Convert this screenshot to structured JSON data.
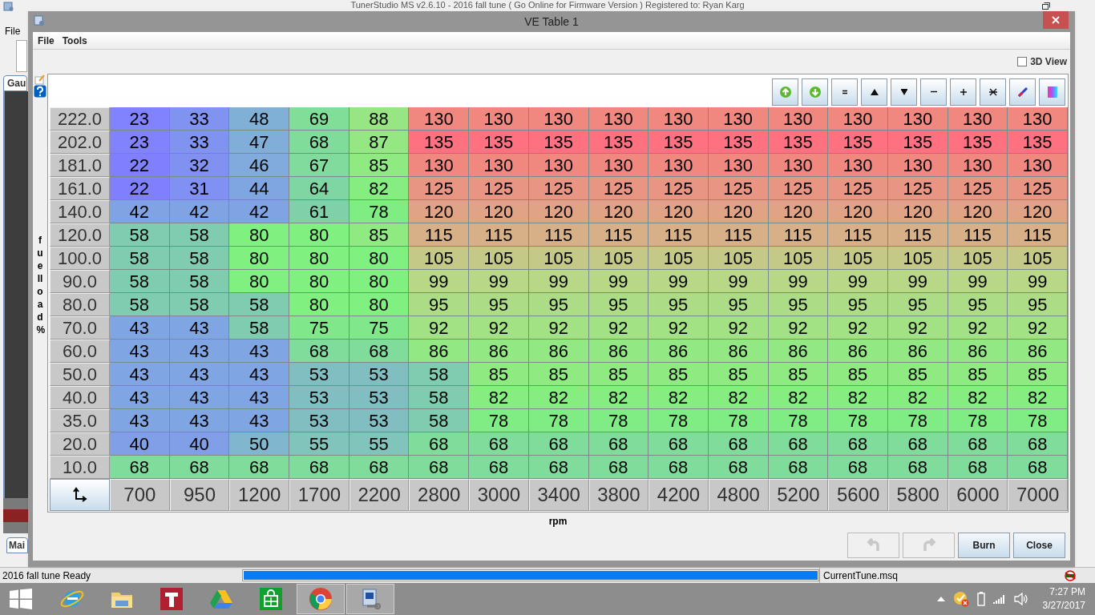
{
  "background_app": {
    "title": "TunerStudio MS v2.6.10 - 2016 fall tune ( Go Online for Firmware Version ) Registered to: Ryan Karg",
    "menu": [
      "File"
    ],
    "tabs": [
      {
        "label": "Gau",
        "selected": true
      },
      {
        "label": "Mai",
        "selected": true
      }
    ]
  },
  "window": {
    "title": "VE Table 1",
    "menu": [
      "File",
      "Tools"
    ]
  },
  "view_3d": {
    "label": "3D View",
    "checked": false
  },
  "table": {
    "y_axis_label": "fuelload %",
    "rows": [
      {
        "load": "222.0",
        "cells": [
          "23",
          "33",
          "48",
          "69",
          "88",
          "130",
          "130",
          "130",
          "130",
          "130",
          "130",
          "130",
          "130",
          "130",
          "130",
          "130"
        ]
      },
      {
        "load": "202.0",
        "cells": [
          "23",
          "33",
          "47",
          "68",
          "87",
          "135",
          "135",
          "135",
          "135",
          "135",
          "135",
          "135",
          "135",
          "135",
          "135",
          "135"
        ]
      },
      {
        "load": "181.0",
        "cells": [
          "22",
          "32",
          "46",
          "67",
          "85",
          "130",
          "130",
          "130",
          "130",
          "130",
          "130",
          "130",
          "130",
          "130",
          "130",
          "130"
        ]
      },
      {
        "load": "161.0",
        "cells": [
          "22",
          "31",
          "44",
          "64",
          "82",
          "125",
          "125",
          "125",
          "125",
          "125",
          "125",
          "125",
          "125",
          "125",
          "125",
          "125"
        ]
      },
      {
        "load": "140.0",
        "cells": [
          "42",
          "42",
          "42",
          "61",
          "78",
          "120",
          "120",
          "120",
          "120",
          "120",
          "120",
          "120",
          "120",
          "120",
          "120",
          "120"
        ]
      },
      {
        "load": "120.0",
        "cells": [
          "58",
          "58",
          "80",
          "80",
          "85",
          "115",
          "115",
          "115",
          "115",
          "115",
          "115",
          "115",
          "115",
          "115",
          "115",
          "115"
        ]
      },
      {
        "load": "100.0",
        "cells": [
          "58",
          "58",
          "80",
          "80",
          "80",
          "105",
          "105",
          "105",
          "105",
          "105",
          "105",
          "105",
          "105",
          "105",
          "105",
          "105"
        ]
      },
      {
        "load": "90.0",
        "cells": [
          "58",
          "58",
          "80",
          "80",
          "80",
          "99",
          "99",
          "99",
          "99",
          "99",
          "99",
          "99",
          "99",
          "99",
          "99",
          "99"
        ]
      },
      {
        "load": "80.0",
        "cells": [
          "58",
          "58",
          "58",
          "80",
          "80",
          "95",
          "95",
          "95",
          "95",
          "95",
          "95",
          "95",
          "95",
          "95",
          "95",
          "95"
        ]
      },
      {
        "load": "70.0",
        "cells": [
          "43",
          "43",
          "58",
          "75",
          "75",
          "92",
          "92",
          "92",
          "92",
          "92",
          "92",
          "92",
          "92",
          "92",
          "92",
          "92"
        ]
      },
      {
        "load": "60.0",
        "cells": [
          "43",
          "43",
          "43",
          "68",
          "68",
          "86",
          "86",
          "86",
          "86",
          "86",
          "86",
          "86",
          "86",
          "86",
          "86",
          "86"
        ]
      },
      {
        "load": "50.0",
        "cells": [
          "43",
          "43",
          "43",
          "53",
          "53",
          "58",
          "85",
          "85",
          "85",
          "85",
          "85",
          "85",
          "85",
          "85",
          "85",
          "85"
        ]
      },
      {
        "load": "40.0",
        "cells": [
          "43",
          "43",
          "43",
          "53",
          "53",
          "58",
          "82",
          "82",
          "82",
          "82",
          "82",
          "82",
          "82",
          "82",
          "82",
          "82"
        ]
      },
      {
        "load": "35.0",
        "cells": [
          "43",
          "43",
          "43",
          "53",
          "53",
          "58",
          "78",
          "78",
          "78",
          "78",
          "78",
          "78",
          "78",
          "78",
          "78",
          "78"
        ]
      },
      {
        "load": "20.0",
        "cells": [
          "40",
          "40",
          "50",
          "55",
          "55",
          "68",
          "68",
          "68",
          "68",
          "68",
          "68",
          "68",
          "68",
          "68",
          "68",
          "68"
        ]
      },
      {
        "load": "10.0",
        "cells": [
          "68",
          "68",
          "68",
          "68",
          "68",
          "68",
          "68",
          "68",
          "68",
          "68",
          "68",
          "68",
          "68",
          "68",
          "68",
          "68"
        ]
      }
    ],
    "x_axis_values": [
      "700",
      "950",
      "1200",
      "1700",
      "2200",
      "2800",
      "3000",
      "3400",
      "3800",
      "4200",
      "4800",
      "5200",
      "5600",
      "5800",
      "6000",
      "7000"
    ],
    "x_axis_label": "rpm"
  },
  "buttons": [
    {
      "kind": "undo",
      "disabled": true
    },
    {
      "kind": "redo",
      "disabled": true
    },
    {
      "kind": "text",
      "label": "Burn",
      "disabled": false
    },
    {
      "kind": "text",
      "label": "Close",
      "disabled": false
    }
  ],
  "status_bar": {
    "message": "2016 fall tune Ready",
    "level": 1,
    "file": "CurrentTune.msq"
  },
  "taskbar": {
    "apps": [
      {
        "kind": "ie",
        "active": false
      },
      {
        "kind": "folder",
        "active": false
      },
      {
        "kind": "t",
        "active": false
      },
      {
        "kind": "drive",
        "active": false
      },
      {
        "kind": "store",
        "active": false
      },
      {
        "kind": "chrome",
        "active": true
      },
      {
        "kind": "tuner",
        "active": true
      }
    ],
    "time": "7:27 PM",
    "date": "3/27/2017"
  }
}
